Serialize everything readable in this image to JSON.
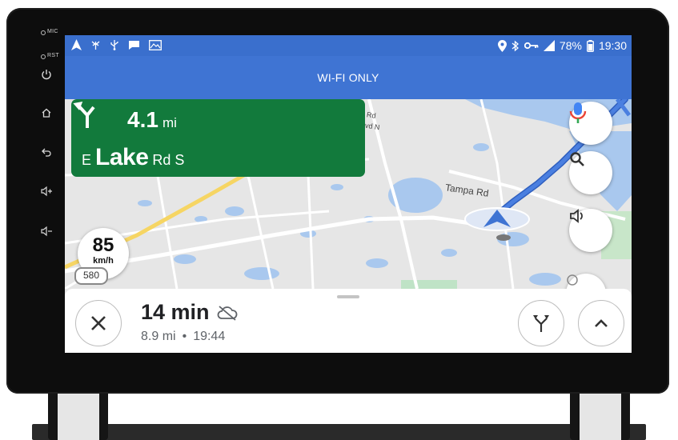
{
  "device": {
    "mic_label": "MIC",
    "rst_label": "RST",
    "side_buttons": [
      "power-icon",
      "home-icon",
      "back-icon",
      "volume-up-icon",
      "volume-down-icon"
    ]
  },
  "statusbar": {
    "left_icons": [
      "navigation-arrow-icon",
      "antenna-icon",
      "usb-icon",
      "chat-icon",
      "image-icon"
    ],
    "battery": "78%",
    "time": "19:30",
    "right_icons": [
      "location-icon",
      "bluetooth-icon",
      "key-icon",
      "signal-icon",
      "battery-icon"
    ]
  },
  "banner": {
    "text": "WI-FI ONLY"
  },
  "navigation": {
    "distance": "4.1",
    "distance_unit": "mi",
    "street_prefix": "E",
    "street_name": "Lake",
    "street_suffix": "Rd S",
    "turn_icon": "turn-slight-left-icon",
    "card_color": "#127a3c"
  },
  "map": {
    "road_label": "Tampa Rd",
    "partial_label_1": "Rd",
    "partial_label_2": "vd N",
    "route_shield": "580"
  },
  "speed": {
    "value": "85",
    "unit": "km/h"
  },
  "trip": {
    "duration": "14 min",
    "distance": "8.9 mi",
    "separator": "•",
    "arrival": "19:44"
  },
  "colors": {
    "statusbar": "#3a6fcd",
    "banner": "#3f74d3",
    "route": "#4a7fe0",
    "water": "#a9c8ee",
    "highway": "#f6d563"
  }
}
